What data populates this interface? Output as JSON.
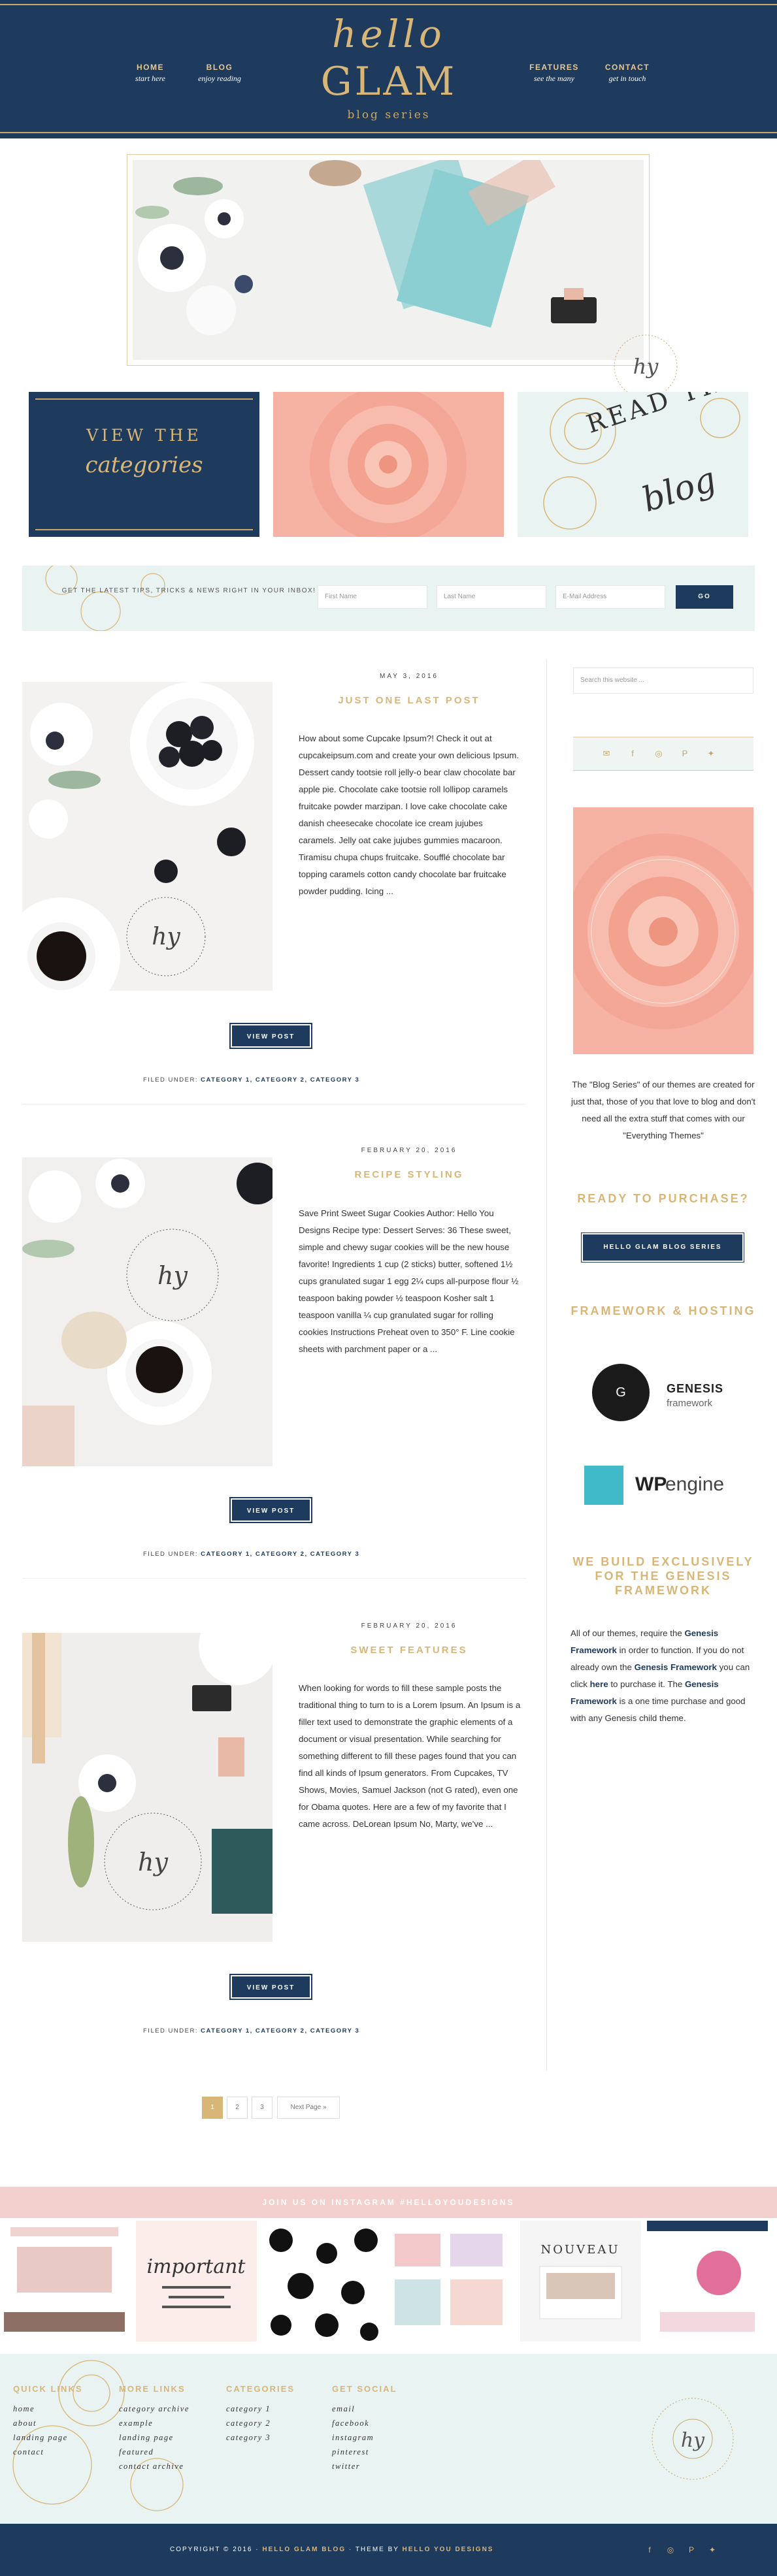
{
  "nav": {
    "home": {
      "title": "HOME",
      "sub": "start here"
    },
    "blog": {
      "title": "BLOG",
      "sub": "enjoy reading"
    },
    "features": {
      "title": "FEATURES",
      "sub": "see the many"
    },
    "contact": {
      "title": "CONTACT",
      "sub": "get in touch"
    }
  },
  "logo": {
    "script": "hello",
    "main": "GLAM",
    "sub": "blog series"
  },
  "tiles": {
    "categories": {
      "line1": "VIEW THE",
      "line2": "categories"
    },
    "read": {
      "line1": "READ THE",
      "line2": "blog"
    }
  },
  "newsletter": {
    "text": "GET THE LATEST TIPS, TRICKS & NEWS RIGHT IN YOUR INBOX!",
    "first_name": "First Name",
    "last_name": "Last Name",
    "email": "E-Mail Address",
    "button": "GO"
  },
  "posts": [
    {
      "date": "MAY 3, 2016",
      "title": "JUST ONE LAST POST",
      "excerpt": "How about some Cupcake Ipsum?! Check it out at cupcakeipsum.com and create your own delicious Ipsum. Dessert candy tootsie roll jelly-o bear claw chocolate bar apple pie. Chocolate cake tootsie roll lollipop caramels fruitcake powder marzipan. I love cake chocolate cake danish cheesecake chocolate ice cream jujubes caramels. Jelly oat cake jujubes gummies macaroon. Tiramisu chupa chups fruitcake. Soufflé chocolate bar topping caramels cotton candy chocolate bar fruitcake powder pudding. Icing ...",
      "button": "VIEW POST",
      "filed_label": "FILED UNDER:",
      "categories": "CATEGORY 1, CATEGORY 2, CATEGORY 3"
    },
    {
      "date": "FEBRUARY 20, 2016",
      "title": "RECIPE STYLING",
      "excerpt": "Save Print Sweet Sugar Cookies Author: Hello You Designs Recipe type: Dessert Serves: 36   These sweet, simple and chewy sugar cookies will be the new house favorite! Ingredients 1 cup (2 sticks) butter, softened 1½ cups granulated sugar 1 egg 2¼ cups all-purpose flour ½ teaspoon baking powder ½ teaspoon Kosher salt 1 teaspoon vanilla ¼ cup granulated sugar for rolling cookies Instructions Preheat oven to 350° F. Line cookie sheets with parchment paper or a ...",
      "button": "VIEW POST",
      "filed_label": "FILED UNDER:",
      "categories": "CATEGORY 1, CATEGORY 2, CATEGORY 3"
    },
    {
      "date": "FEBRUARY 20, 2016",
      "title": "SWEET FEATURES",
      "excerpt": "When looking for words to fill these sample posts the traditional thing to turn to is a Lorem Ipsum. An Ipsum is a filler text used to demonstrate the graphic elements of a document or visual presentation. While searching for something different to fill these pages found that you can find all kinds of Ipsum generators. From Cupcakes, TV Shows, Movies, Samuel Jackson (not G rated), even one for Obama quotes. Here are a few of my favorite that I came across. DeLorean Ipsum No, Marty, we've ...",
      "button": "VIEW POST",
      "filed_label": "FILED UNDER:",
      "categories": "CATEGORY 1, CATEGORY 2, CATEGORY 3"
    }
  ],
  "pagination": {
    "p1": "1",
    "p2": "2",
    "p3": "3",
    "next": "Next Page »"
  },
  "sidebar": {
    "search_placeholder": "Search this website ...",
    "about": "The \"Blog Series\" of our themes are created for just that, those of you that love to blog and don't need all the extra stuff that comes with our \"Everything Themes\"",
    "ready_heading": "READY TO PURCHASE?",
    "ready_button": "HELLO GLAM BLOG SERIES",
    "framework_heading": "FRAMEWORK & HOSTING",
    "genesis_name": "GENESIS",
    "genesis_sub": "framework",
    "genesis_letter": "G",
    "wpengine_wp": "WP",
    "wpengine_engine": "engine",
    "build_heading": "WE BUILD EXCLUSIVELY FOR THE GENESIS FRAMEWORK",
    "build_t1": "All of our themes, require the ",
    "build_b1": "Genesis Framework",
    "build_t2": " in order to function. If you do not already own the ",
    "build_b2": "Genesis Framework",
    "build_t3": " you can click ",
    "build_b3": "here",
    "build_t4": " to purchase it. The ",
    "build_b4": "Genesis Framework",
    "build_t5": " is a one time purchase and good with any Genesis child theme."
  },
  "instagram": {
    "bar_text": "JOIN US ON INSTAGRAM #HELLOYOUDESIGNS",
    "img2_text": "important",
    "img5_text": "NOUVEAU"
  },
  "footer": {
    "col1": {
      "heading": "QUICK LINKS",
      "links": [
        "home",
        "about",
        "landing page",
        "contact"
      ]
    },
    "col2": {
      "heading": "MORE LINKS",
      "links": [
        "category archive",
        "example",
        "landing page",
        "featured",
        "contact archive"
      ]
    },
    "col3": {
      "heading": "CATEGORIES",
      "links": [
        "category 1",
        "category 2",
        "category 3"
      ]
    },
    "col4": {
      "heading": "GET SOCIAL",
      "links": [
        "email",
        "facebook",
        "instagram",
        "pinterest",
        "twitter"
      ]
    },
    "copyright_pre": "COPYRIGHT © 2016 · ",
    "copyright_site": "HELLO GLAM BLOG",
    "copyright_mid": " · THEME BY ",
    "copyright_author": "HELLO YOU DESIGNS"
  },
  "colors": {
    "navy": "#1e3a5c",
    "gold": "#d8b677",
    "blush": "#f3cfcd",
    "mint": "#e9f3f2",
    "peony": "#f6b3a4"
  }
}
